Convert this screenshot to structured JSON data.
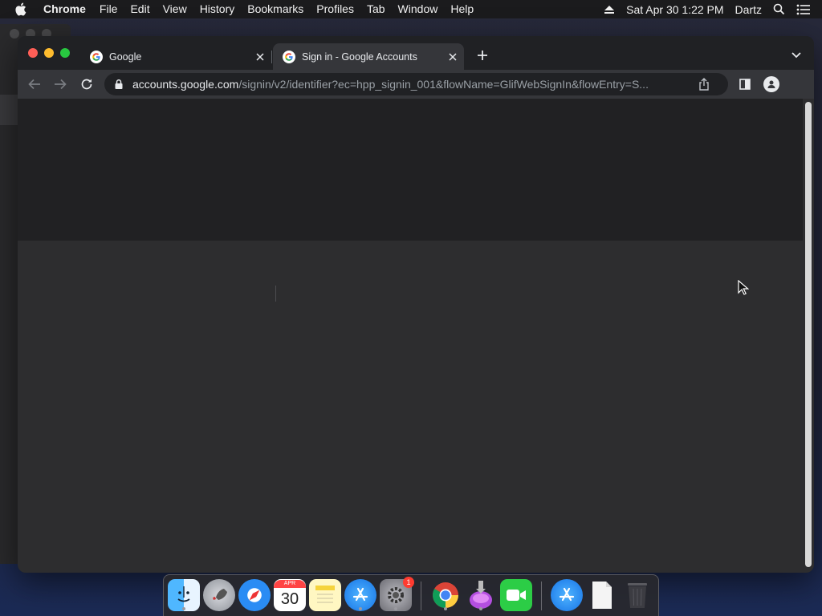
{
  "menubar": {
    "app_name": "Chrome",
    "items": [
      "File",
      "Edit",
      "View",
      "History",
      "Bookmarks",
      "Profiles",
      "Tab",
      "Window",
      "Help"
    ],
    "clock": "Sat Apr 30  1:22 PM",
    "user": "Dartz"
  },
  "tabs": [
    {
      "title": "Google",
      "active": false
    },
    {
      "title": "Sign in - Google Accounts",
      "active": true
    }
  ],
  "omnibox": {
    "host": "accounts.google.com",
    "path": "/signin/v2/identifier?ec=hpp_signin_001&flowName=GlifWebSignIn&flowEntry=S..."
  },
  "dock": {
    "calendar_month": "APR",
    "calendar_day": "30",
    "settings_badge": "1"
  },
  "colors": {
    "menubar_bg": "#1b1b1d",
    "tabstrip_bg": "#202124",
    "active_tab_bg": "#35363a",
    "page_top_bg": "#212123",
    "page_bg": "#2d2d2f"
  }
}
